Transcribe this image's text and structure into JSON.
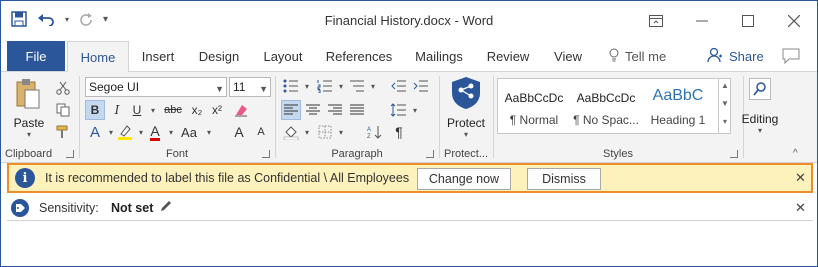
{
  "titlebar": {
    "title": "Financial History.docx  -  Word",
    "qat": {
      "save_icon": "save-icon",
      "undo_icon": "undo-icon",
      "redo_icon": "redo-icon",
      "customize_icon": "customize-qat-icon"
    },
    "window_controls": [
      "ribbon-display-icon",
      "minimize-icon",
      "maximize-icon",
      "close-icon"
    ]
  },
  "tabs": {
    "file": "File",
    "items": [
      {
        "label": "Home",
        "active": true
      },
      {
        "label": "Insert",
        "active": false
      },
      {
        "label": "Design",
        "active": false
      },
      {
        "label": "Layout",
        "active": false
      },
      {
        "label": "References",
        "active": false
      },
      {
        "label": "Mailings",
        "active": false
      },
      {
        "label": "Review",
        "active": false
      },
      {
        "label": "View",
        "active": false
      }
    ],
    "tell_me": "Tell me",
    "share": "Share"
  },
  "ribbon": {
    "clipboard": {
      "label": "Clipboard",
      "paste": "Paste"
    },
    "font": {
      "label": "Font",
      "font_name": "Segoe UI",
      "font_size": "11",
      "bold": "B",
      "italic": "I",
      "underline": "U",
      "strike": "abc",
      "subscript": "x₂",
      "superscript": "x²",
      "font_color_letter": "A",
      "change_case": "Aa",
      "grow": "A",
      "shrink": "A"
    },
    "paragraph": {
      "label": "Paragraph",
      "pilcrow": "¶"
    },
    "protection": {
      "label": "Protect...",
      "protect": "Protect"
    },
    "styles": {
      "label": "Styles",
      "items": [
        {
          "sample": "AaBbCcDc",
          "name": "¶ Normal"
        },
        {
          "sample": "AaBbCcDc",
          "name": "¶ No Spac..."
        },
        {
          "sample": "AaBbC",
          "name": "Heading 1"
        }
      ]
    },
    "editing": {
      "label": "Editing"
    }
  },
  "infobar": {
    "message": "It is recommended to label this file as Confidential \\ All Employees",
    "change_now": "Change now",
    "dismiss": "Dismiss",
    "close": "✕"
  },
  "sensitivity": {
    "label": "Sensitivity:",
    "value": "Not set",
    "close": "✕"
  },
  "colors": {
    "accent": "#2b579a",
    "infobar_bg": "#fdf2bc",
    "infobar_border": "#f08d2b",
    "ribbon_bg": "#f3f3f3"
  }
}
